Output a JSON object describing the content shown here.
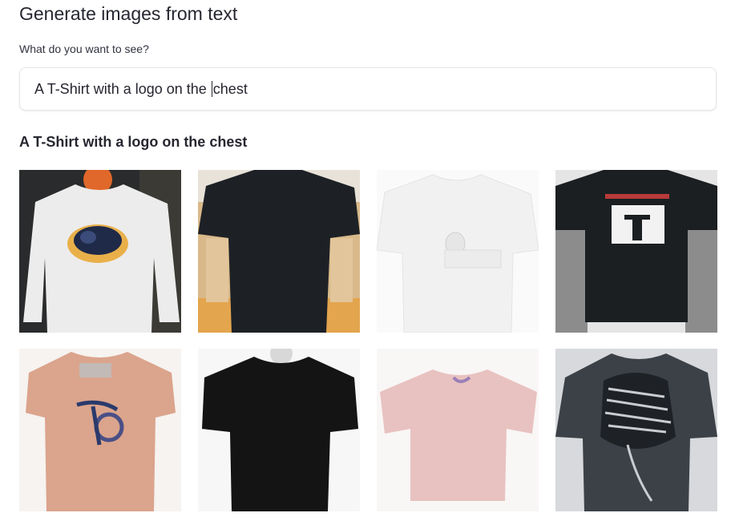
{
  "header": {
    "title": "Generate images from text"
  },
  "prompt_field": {
    "label": "What do you want to see?",
    "value_before_caret": "A T-Shirt with a logo on the ",
    "value_after_caret": "chest"
  },
  "results": {
    "heading": "A T-Shirt with a logo on the chest",
    "images": [
      {
        "id": "img1",
        "shirt_color": "#ececec",
        "bg": "#2a2b2c",
        "logo": "oval-logo"
      },
      {
        "id": "img2",
        "shirt_color": "#1d2126",
        "bg": "#d9b98a",
        "logo": "none"
      },
      {
        "id": "img3",
        "shirt_color": "#f4f4f4",
        "bg": "#fafafa",
        "logo": "small-pocket-logo"
      },
      {
        "id": "img4",
        "shirt_color": "#1b1f21",
        "bg": "#e5e5e5",
        "logo": "square-logo"
      },
      {
        "id": "img5",
        "shirt_color": "#dba48c",
        "bg": "#f6f3f0",
        "logo": "bike-logo"
      },
      {
        "id": "img6",
        "shirt_color": "#141414",
        "bg": "#f7f7f7",
        "logo": "none"
      },
      {
        "id": "img7",
        "shirt_color": "#e8c2c0",
        "bg": "#f9f6f6",
        "logo": "small-neck-logo"
      },
      {
        "id": "img8",
        "shirt_color": "#3b4147",
        "bg": "#d7d9dc",
        "logo": "pattern-logo"
      }
    ]
  }
}
